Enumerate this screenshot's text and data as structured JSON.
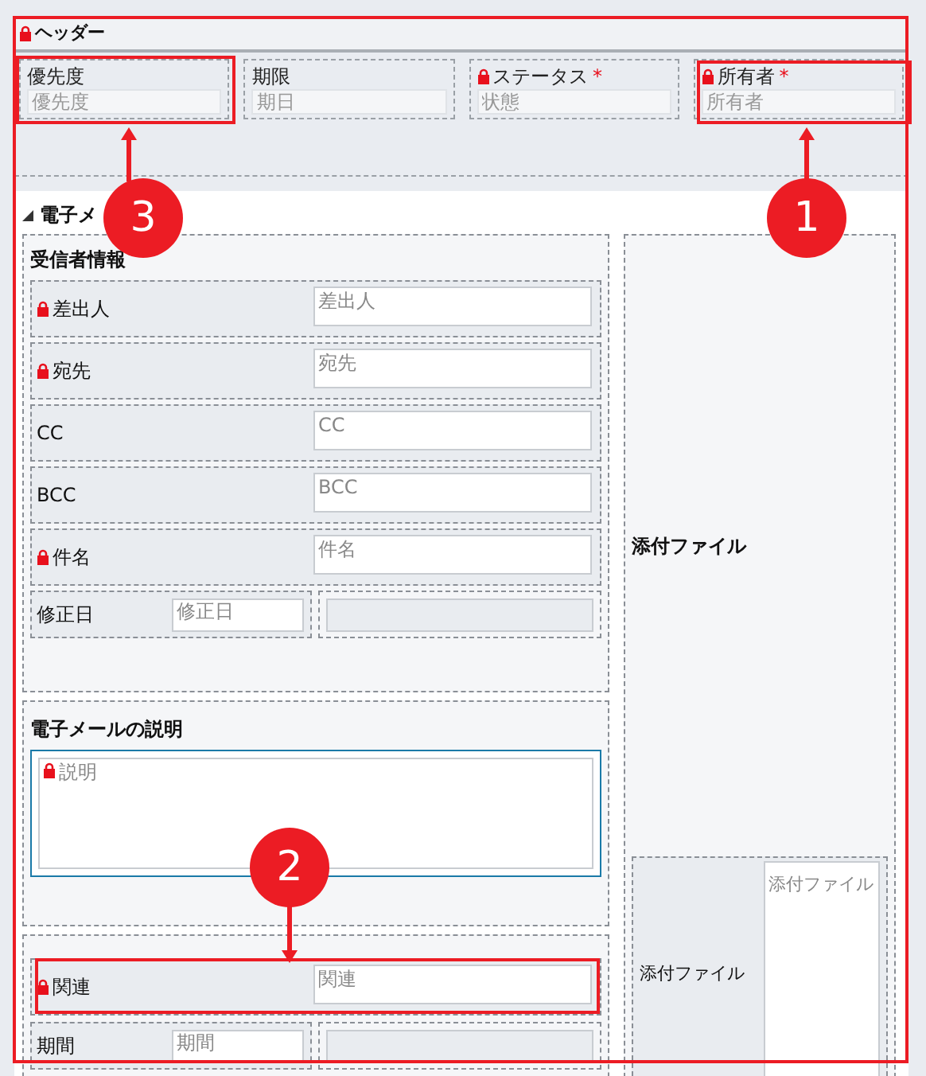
{
  "header": {
    "title": "ヘッダー",
    "locked": true,
    "fields": [
      {
        "label": "優先度",
        "placeholder": "優先度",
        "locked": false
      },
      {
        "label": "期限",
        "placeholder": "期日",
        "locked": false
      },
      {
        "label": "ステータス",
        "placeholder": "状態",
        "locked": true,
        "required_mark": "*"
      },
      {
        "label": "所有者",
        "placeholder": "所有者",
        "locked": true,
        "required_mark": "*"
      }
    ]
  },
  "tab_section": {
    "title": "電子メ",
    "expanded": true
  },
  "recipient_section": {
    "title": "受信者情報",
    "rows": [
      {
        "kind": "full",
        "label": "差出人",
        "placeholder": "差出人",
        "locked": true
      },
      {
        "kind": "full",
        "label": "宛先",
        "placeholder": "宛先",
        "locked": true
      },
      {
        "kind": "full",
        "label": "CC",
        "placeholder": "CC",
        "locked": false
      },
      {
        "kind": "full",
        "label": "BCC",
        "placeholder": "BCC",
        "locked": false
      },
      {
        "kind": "full",
        "label": "件名",
        "placeholder": "件名",
        "locked": true
      },
      {
        "kind": "split",
        "label": "修正日",
        "placeholder": "修正日",
        "locked": false
      }
    ]
  },
  "description_section": {
    "title": "電子メールの説明",
    "placeholder": "説明",
    "locked": true
  },
  "related_section": {
    "rows": [
      {
        "kind": "full",
        "label": "関連",
        "placeholder": "関連",
        "locked": true
      },
      {
        "kind": "split",
        "label": "期間",
        "placeholder": "期間",
        "locked": false
      }
    ]
  },
  "attachment_section": {
    "title": "添付ファイル",
    "label": "添付ファイル",
    "placeholder": "添付ファイル"
  },
  "annotations": [
    {
      "number": "1"
    },
    {
      "number": "2"
    },
    {
      "number": "3"
    }
  ]
}
